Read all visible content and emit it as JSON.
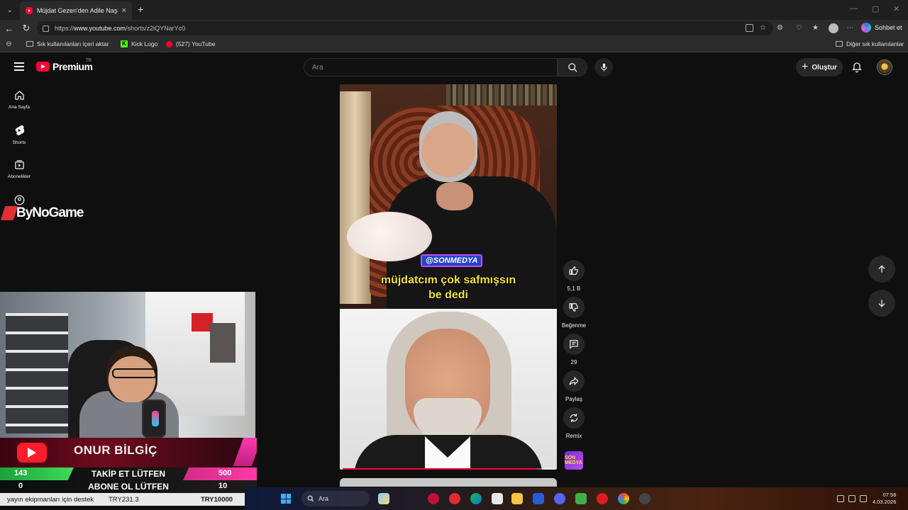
{
  "browser": {
    "tab_title": "Müjdat Gezen'den Adile Naşit",
    "url_prefix": "https://",
    "url_host": "www.youtube.com",
    "url_path": "/shorts/z2iQYNarYc0",
    "copilot_label": "Sohbet et",
    "bookmarks": [
      {
        "label": "Sık kullanılanları içeri aktar",
        "icon": "folder-icon"
      },
      {
        "label": "Kick Logo",
        "icon": "kick-icon"
      },
      {
        "label": "(527) YouTube",
        "icon": "youtube-icon"
      }
    ],
    "other_bookmarks": "Diğer sık kullanılanlar"
  },
  "youtube": {
    "logo_word": "Premium",
    "country_code": "TR",
    "search_placeholder": "Ara",
    "create_label": "Oluştur",
    "sidebar": [
      {
        "label": "Ana Sayfa",
        "icon": "home-icon"
      },
      {
        "label": "Shorts",
        "icon": "shorts-icon"
      },
      {
        "label": "Abonelikler",
        "icon": "subscriptions-icon"
      }
    ],
    "short": {
      "handle_badge": "@SONMEDYA",
      "subtitle_line1": "müjdatcım çok safmışsın",
      "subtitle_line2": "be dedi",
      "progress": 0.92
    },
    "actions": {
      "like_count": "5,1 B",
      "dislike_label": "Beğenme",
      "comment_count": "29",
      "share_label": "Paylaş",
      "remix_label": "Remix",
      "sound_label": "SON MEDYA"
    }
  },
  "overlay": {
    "sponsor_logo": "ByNoGame",
    "streamer_name": "ONUR BİLGİÇ",
    "follow_current": "143",
    "follow_text": "TAKİP ET LÜTFEN",
    "follow_goal": "500",
    "sub_current": "0",
    "sub_text": "ABONE OL LÜTFEN",
    "sub_goal": "10",
    "ticker_text": "yayın ekipmanları için destek",
    "ticker_try1": "TRY231.3",
    "ticker_try2": "TRY10000"
  },
  "taskbar": {
    "search_label": "Ara",
    "time": "07:56",
    "date": "4.03.2026"
  },
  "colors": {
    "yt_red": "#ff0033",
    "background": "#0f0f0f",
    "subtitle_yellow": "#f7e53a"
  }
}
